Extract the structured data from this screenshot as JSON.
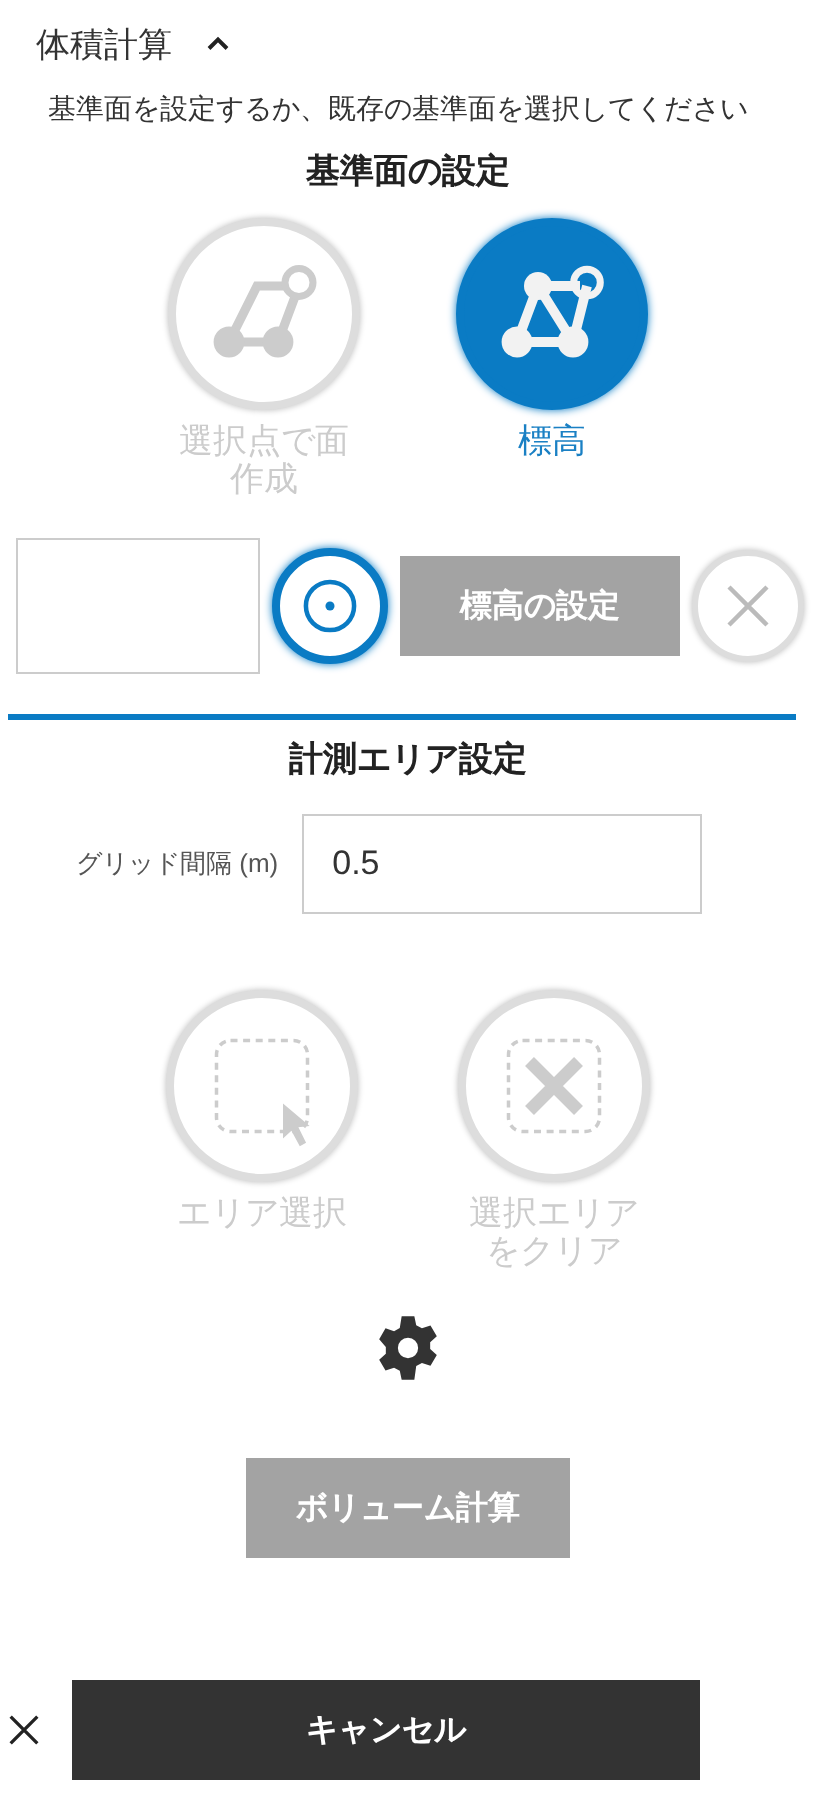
{
  "panel": {
    "title": "体積計算",
    "expanded": true
  },
  "instruction": "基準面を設定するか、既存の基準面を選択してください",
  "reference": {
    "heading": "基準面の設定",
    "modes": [
      {
        "kind": "points",
        "label": "選択点で面作成",
        "selected": false,
        "disabled": true
      },
      {
        "kind": "elevation",
        "label": "標高",
        "selected": true,
        "disabled": false
      }
    ],
    "pick": {
      "active": true
    },
    "set_button": {
      "label": "標高の設定",
      "disabled": true
    },
    "clear": {
      "disabled": true
    }
  },
  "area": {
    "heading": "計測エリア設定",
    "grid_label": "グリッド間隔 (m)",
    "grid_value": "0.5",
    "tools": [
      {
        "kind": "select",
        "label": "エリア選択",
        "disabled": true
      },
      {
        "kind": "clear",
        "label": "選択エリアをクリア",
        "disabled": true
      }
    ]
  },
  "volume_button": {
    "label": "ボリューム計算",
    "disabled": true
  },
  "cancel_button": {
    "label": "キャンセル"
  }
}
